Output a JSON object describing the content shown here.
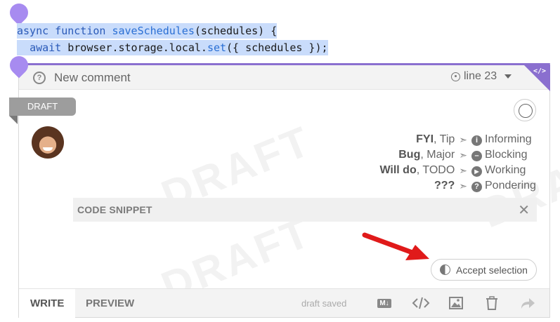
{
  "code": {
    "line1": {
      "kw": "async function ",
      "fn": "saveSchedules",
      "rest": "(schedules) {"
    },
    "line2": {
      "indent": "  ",
      "kw": "await",
      "mid": " browser.storage.local.",
      "fn": "set",
      "rest": "({ schedules });"
    }
  },
  "comment": {
    "header_icon": "question-bubble-icon",
    "title": "New comment",
    "line_label": "line 23",
    "corner_icon_text": "</>"
  },
  "draft_tag": "DRAFT",
  "watermark": "DRAFT",
  "legend": [
    {
      "labels_bold": "FYI",
      "labels_rest": ", Tip",
      "icon": "info-icon",
      "icon_glyph": "i",
      "status": "Informing"
    },
    {
      "labels_bold": "Bug",
      "labels_rest": ", Major",
      "icon": "block-icon",
      "icon_glyph": "–",
      "status": "Blocking"
    },
    {
      "labels_bold": "Will do",
      "labels_rest": ", TODO",
      "icon": "play-icon",
      "icon_glyph": "▶",
      "status": "Working"
    },
    {
      "labels_bold": "???",
      "labels_rest": "",
      "icon": "question-icon",
      "icon_glyph": "?",
      "status": "Pondering"
    }
  ],
  "legend_arrow": "➣",
  "snippet": {
    "title": "CODE SNIPPET",
    "close": "✕"
  },
  "accept_label": "Accept selection",
  "bottom": {
    "tab_write": "WRITE",
    "tab_preview": "PREVIEW",
    "draft_status": "draft saved",
    "markdown_badge": "M↓"
  },
  "colors": {
    "accent": "#8a6fcf",
    "selection": "#c9dcfb",
    "arrow": "#e01a1a"
  }
}
